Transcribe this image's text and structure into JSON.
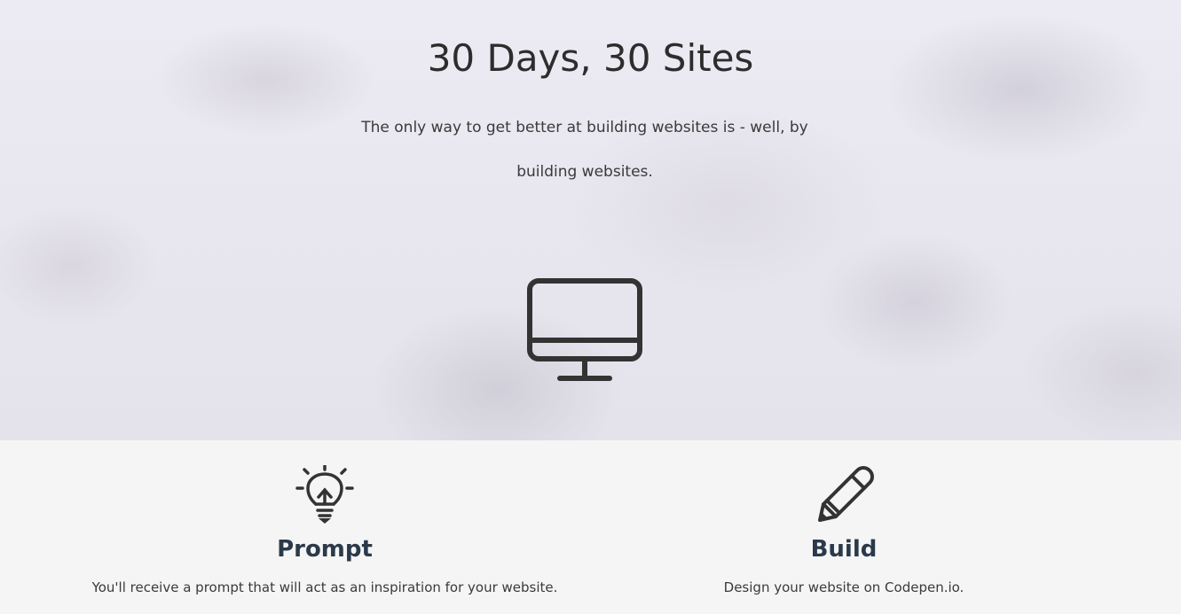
{
  "hero": {
    "title": "30 Days, 30 Sites",
    "subtitle": "The only way to get better at building websites is - well, by building websites.",
    "icon": "monitor-icon"
  },
  "features": [
    {
      "icon": "lightbulb-icon",
      "title": "Prompt",
      "text": "You'll receive a prompt that will act as an inspiration for your website."
    },
    {
      "icon": "pencil-icon",
      "title": "Build",
      "text": "Design your website on Codepen.io."
    }
  ],
  "colors": {
    "title": "#2d2d2d",
    "feature_title": "#2b3a4a",
    "icon_stroke": "#333333",
    "features_bg": "#f5f5f5"
  }
}
